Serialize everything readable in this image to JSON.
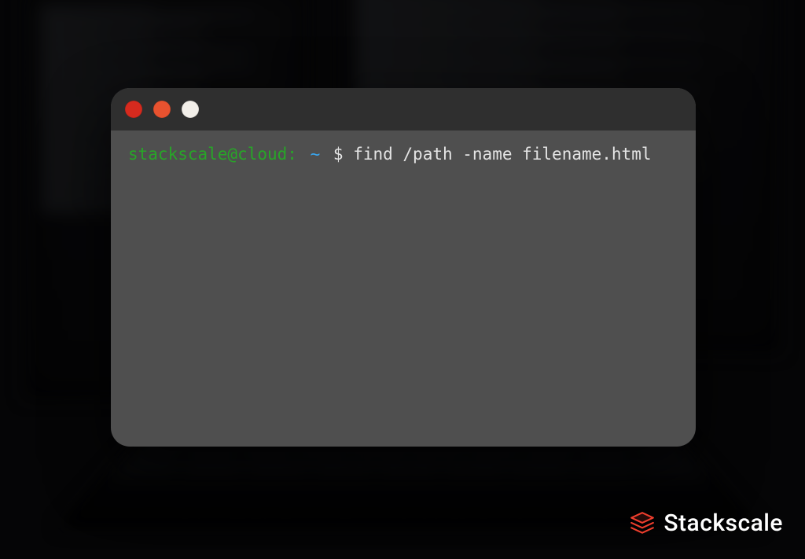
{
  "terminal": {
    "prompt_user": "stackscale@cloud:",
    "prompt_tilde": "~",
    "command": "$ find /path -name filename.html"
  },
  "brand": {
    "name": "Stackscale"
  },
  "colors": {
    "traffic_red": "#d62a1e",
    "traffic_orange": "#e8522f",
    "traffic_white": "#f2efe9",
    "prompt_green": "#28a528",
    "prompt_blue": "#39a6ef",
    "brand_accent": "#ef3e2d"
  }
}
